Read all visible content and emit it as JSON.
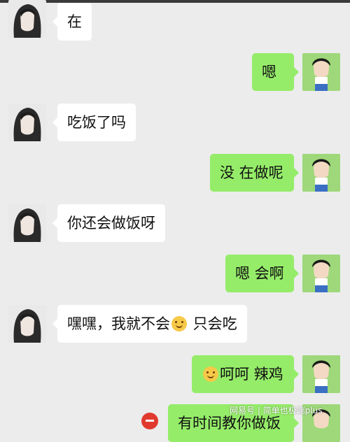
{
  "colors": {
    "background": "#ececec",
    "incoming_bubble": "#ffffff",
    "outgoing_bubble": "#95ec69",
    "emoji": "#f7c948"
  },
  "messages": [
    {
      "side": "in",
      "text": "在"
    },
    {
      "side": "out",
      "text": "嗯"
    },
    {
      "side": "in",
      "text": "吃饭了吗"
    },
    {
      "side": "out",
      "text": "没 在做呢"
    },
    {
      "side": "in",
      "text": "你还会做饭呀"
    },
    {
      "side": "out",
      "text": "嗯 会啊"
    },
    {
      "side": "in",
      "text_before": "嘿嘿，我就不会",
      "emoji": "smile-emoji",
      "text_after": " 只会吃"
    },
    {
      "side": "out",
      "emoji": "smile-emoji",
      "text_after": "呵呵 辣鸡"
    },
    {
      "side": "out",
      "text": "有时间教你做饭"
    }
  ],
  "watermark": "网易号 | 简单也极端plus"
}
